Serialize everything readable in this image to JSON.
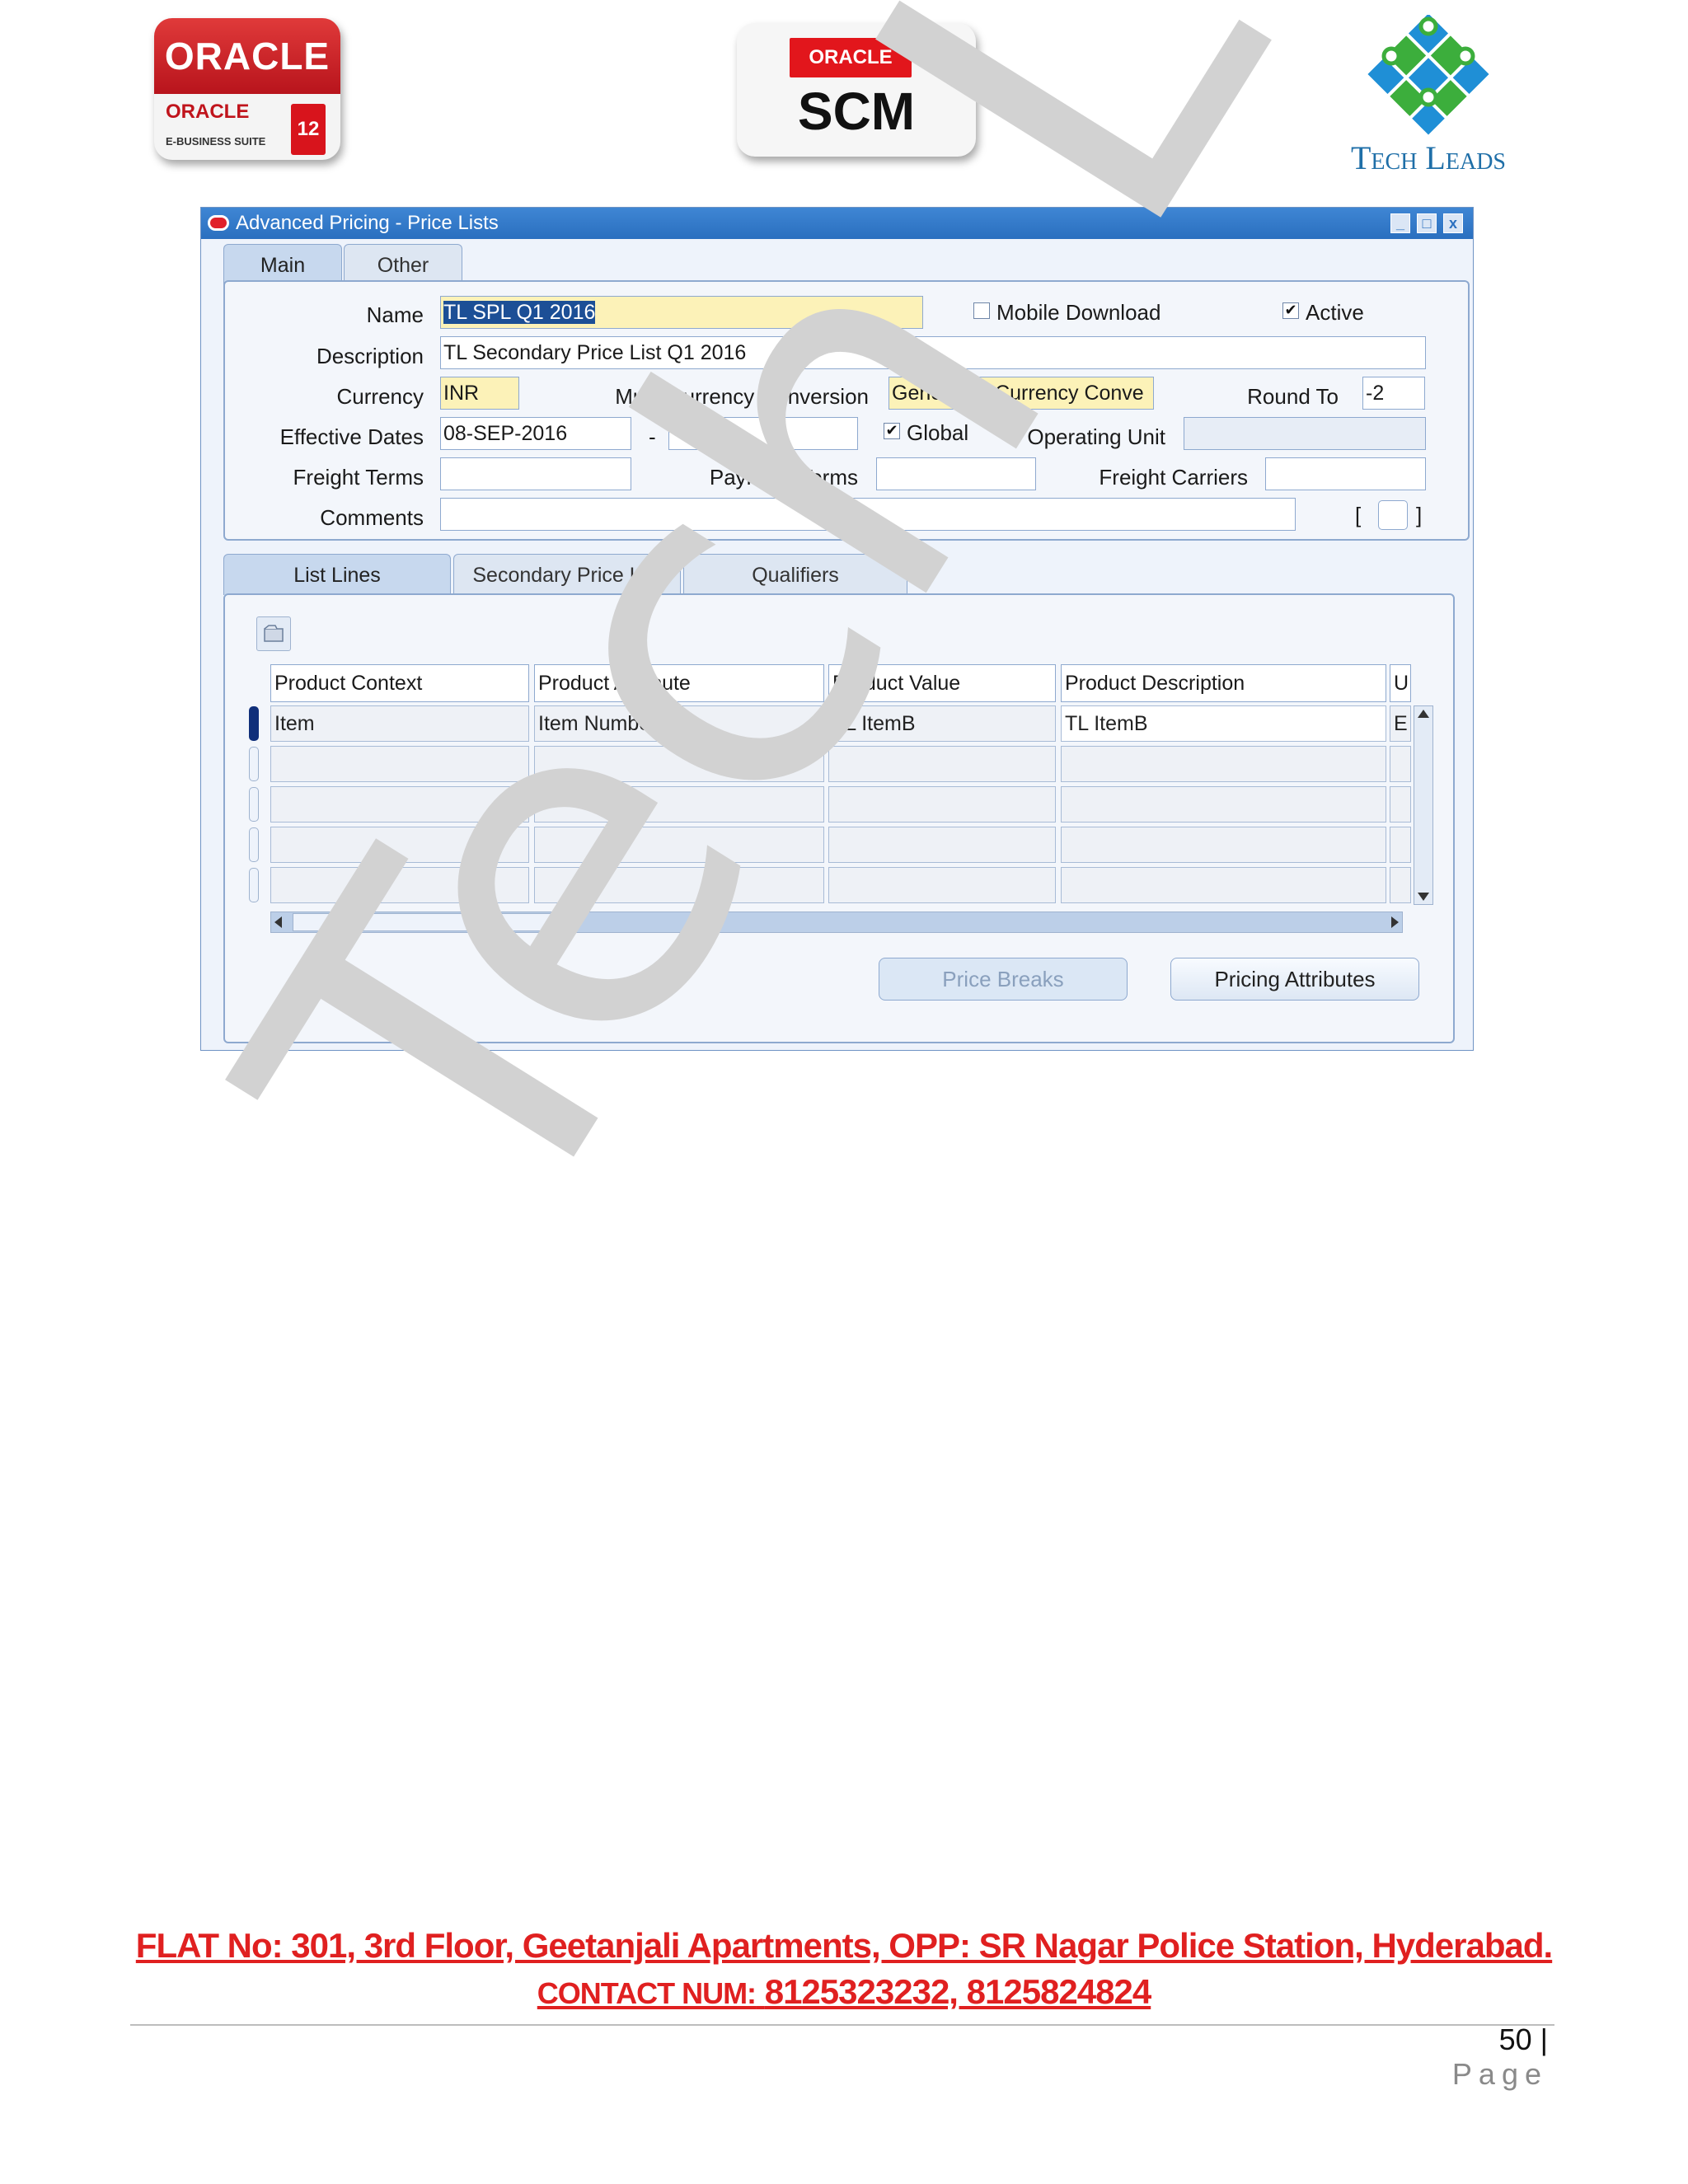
{
  "logos": {
    "oracle_ebs": {
      "top": "ORACLE",
      "sub": "ORACLE",
      "suite": "E-BUSINESS SUITE",
      "release": "12"
    },
    "oracle_scm": {
      "tag": "ORACLE",
      "name": "SCM"
    },
    "tech_leads": {
      "name": "Tech Leads",
      "colors": [
        "#1f8fd6",
        "#3cae3c"
      ]
    }
  },
  "window": {
    "title": "Advanced Pricing - Price Lists",
    "controls": {
      "minimize": "_",
      "maximize": "□",
      "close": "x"
    }
  },
  "main_tabs": [
    {
      "label": "Main",
      "active": true
    },
    {
      "label": "Other",
      "active": false
    }
  ],
  "header_form": {
    "name": {
      "label": "Name",
      "value": "TL SPL Q1 2016"
    },
    "mobile_download": {
      "label": "Mobile Download",
      "checked": false
    },
    "active": {
      "label": "Active",
      "checked": true
    },
    "description": {
      "label": "Description",
      "value": "TL Secondary Price List Q1 2016"
    },
    "currency": {
      "label": "Currency",
      "value": "INR"
    },
    "multi_currency_conversion": {
      "label": "Multi-Currency Conversion",
      "value": "Generated Currency Conve"
    },
    "round_to": {
      "label": "Round To",
      "value": "-2"
    },
    "effective_dates": {
      "label": "Effective Dates",
      "from": "08-SEP-2016",
      "separator": "-",
      "to": ""
    },
    "global": {
      "label": "Global",
      "checked": true
    },
    "operating_unit": {
      "label": "Operating Unit",
      "value": ""
    },
    "freight_terms": {
      "label": "Freight Terms",
      "value": ""
    },
    "payment_terms": {
      "label": "Payment Terms",
      "value": ""
    },
    "freight_carriers": {
      "label": "Freight Carriers",
      "value": ""
    },
    "comments": {
      "label": "Comments",
      "value": ""
    },
    "flex_open": "[",
    "flex_close": "]"
  },
  "detail_tabs": [
    {
      "label": "List Lines",
      "active": true
    },
    {
      "label": "Secondary Price List",
      "active": false
    },
    {
      "label": "Qualifiers",
      "active": false
    }
  ],
  "lines_table": {
    "columns": [
      "Product Context",
      "Product Attribute",
      "Product Value",
      "Product Description",
      "U"
    ],
    "rows": [
      [
        "Item",
        "Item Number",
        "TL ItemB",
        "TL ItemB",
        "E"
      ],
      [
        "",
        "",
        "",
        "",
        ""
      ],
      [
        "",
        "",
        "",
        "",
        ""
      ],
      [
        "",
        "",
        "",
        "",
        ""
      ],
      [
        "",
        "",
        "",
        "",
        ""
      ]
    ]
  },
  "buttons": {
    "price_breaks": "Price Breaks",
    "pricing_attributes": "Pricing Attributes"
  },
  "watermark": "Tech L",
  "footer": {
    "address": "FLAT No: 301, 3rd Floor, Geetanjali Apartments, OPP: SR Nagar Police Station, Hyderabad.",
    "contact_label": "CONTACT NUM:",
    "contact_numbers": "8125323232, 8125824824",
    "page_number": "50",
    "page_separator": "|",
    "page_word": "Page"
  },
  "colors": {
    "title_bar": "#2a6fbf",
    "required_field": "#fcf2b8",
    "footer_text": "#e02020"
  }
}
